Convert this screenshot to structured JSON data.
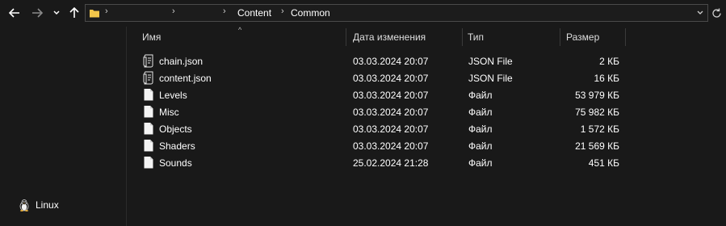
{
  "nav": {
    "back_icon": "arrow-left-icon",
    "forward_icon": "arrow-right-icon",
    "recent_icon": "chevron-down-icon",
    "up_icon": "arrow-up-icon"
  },
  "address": {
    "folder_icon": "folder-icon",
    "separators": [
      "›",
      "›",
      "›",
      "›"
    ],
    "crumbs": [
      "Content",
      "Common"
    ],
    "dropdown_icon": "chevron-down-icon",
    "refresh_icon": "refresh-icon"
  },
  "sidebar": {
    "items": [
      {
        "label": "Linux",
        "icon": "tux-icon"
      }
    ]
  },
  "columns": {
    "name": "Имя",
    "date": "Дата изменения",
    "type": "Тип",
    "size": "Размер",
    "sort_indicator": "^"
  },
  "files": [
    {
      "name": "chain.json",
      "date": "03.03.2024 20:07",
      "type": "JSON File",
      "size": "2 КБ",
      "icon": "json-file-icon"
    },
    {
      "name": "content.json",
      "date": "03.03.2024 20:07",
      "type": "JSON File",
      "size": "16 КБ",
      "icon": "json-file-icon"
    },
    {
      "name": "Levels",
      "date": "03.03.2024 20:07",
      "type": "Файл",
      "size": "53 979 КБ",
      "icon": "file-icon"
    },
    {
      "name": "Misc",
      "date": "03.03.2024 20:07",
      "type": "Файл",
      "size": "75 982 КБ",
      "icon": "file-icon"
    },
    {
      "name": "Objects",
      "date": "03.03.2024 20:07",
      "type": "Файл",
      "size": "1 572 КБ",
      "icon": "file-icon"
    },
    {
      "name": "Shaders",
      "date": "03.03.2024 20:07",
      "type": "Файл",
      "size": "21 569 КБ",
      "icon": "file-icon"
    },
    {
      "name": "Sounds",
      "date": "25.02.2024 21:28",
      "type": "Файл",
      "size": "451 КБ",
      "icon": "file-icon"
    }
  ],
  "colors": {
    "background": "#191919",
    "text": "#ffffff",
    "folder": "#f3c64a"
  }
}
